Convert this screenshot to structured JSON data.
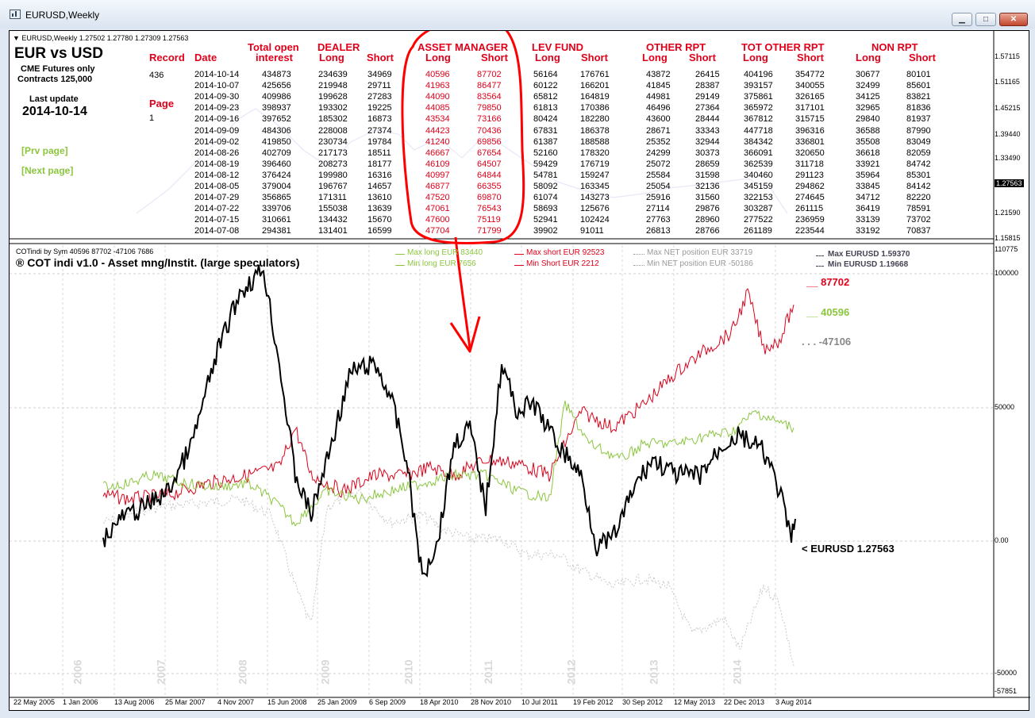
{
  "window": {
    "title": "EURUSD,Weekly",
    "buttons": {
      "minimize": "▁",
      "restore": "□",
      "close": "✕"
    }
  },
  "top_chart": {
    "info": "▼ EURUSD,Weekly  1.27502 1.27780 1.27309 1.27563",
    "yticks": [
      "1.57115",
      "1.51165",
      "1.45215",
      "1.39440",
      "1.33490",
      "1.27563",
      "1.21590",
      "1.15815"
    ],
    "current_price": "1.27563"
  },
  "panel": {
    "title": "EUR vs USD",
    "sub1": "CME Futures only",
    "sub2": "Contracts 125,000",
    "last_update_label": "Last update",
    "last_update": "2014-10-14",
    "prev_page": "[Prv page]",
    "next_page": "[Next page]",
    "record_label": "Record",
    "record_value": "436",
    "page_label": "Page",
    "page_value": "1"
  },
  "table": {
    "h_date": "Date",
    "h_oi_1": "Total open",
    "h_oi_2": "interest",
    "groups": [
      "DEALER",
      "ASSET MANAGER",
      "LEV FUND",
      "OTHER RPT",
      "TOT OTHER RPT",
      "NON RPT"
    ],
    "sub_long": "Long",
    "sub_short": "Short",
    "rows": [
      [
        "2014-10-14",
        "434873",
        "234639",
        "34969",
        "40596",
        "87702",
        "56164",
        "176761",
        "43872",
        "26415",
        "404196",
        "354772",
        "30677",
        "80101"
      ],
      [
        "2014-10-07",
        "425656",
        "219948",
        "29711",
        "41963",
        "86477",
        "60122",
        "166201",
        "41845",
        "28387",
        "393157",
        "340055",
        "32499",
        "85601"
      ],
      [
        "2014-09-30",
        "409986",
        "199628",
        "27283",
        "44090",
        "83564",
        "65812",
        "164819",
        "44981",
        "29149",
        "375861",
        "326165",
        "34125",
        "83821"
      ],
      [
        "2014-09-23",
        "398937",
        "193302",
        "19225",
        "44085",
        "79850",
        "61813",
        "170386",
        "46496",
        "27364",
        "365972",
        "317101",
        "32965",
        "81836"
      ],
      [
        "2014-09-16",
        "397652",
        "185302",
        "16873",
        "43534",
        "73166",
        "80424",
        "182280",
        "43600",
        "28444",
        "367812",
        "315715",
        "29840",
        "81937"
      ],
      [
        "2014-09-09",
        "484306",
        "228008",
        "27374",
        "44423",
        "70436",
        "67831",
        "186378",
        "28671",
        "33343",
        "447718",
        "396316",
        "36588",
        "87990"
      ],
      [
        "2014-09-02",
        "419850",
        "230734",
        "19784",
        "41240",
        "69856",
        "61387",
        "188588",
        "25352",
        "32944",
        "384342",
        "336801",
        "35508",
        "83049"
      ],
      [
        "2014-08-26",
        "402709",
        "217173",
        "18511",
        "46667",
        "67654",
        "52160",
        "178320",
        "24299",
        "30373",
        "366091",
        "320650",
        "36618",
        "82059"
      ],
      [
        "2014-08-19",
        "396460",
        "208273",
        "18177",
        "46109",
        "64507",
        "59429",
        "176719",
        "25072",
        "28659",
        "362539",
        "311718",
        "33921",
        "84742"
      ],
      [
        "2014-08-12",
        "376424",
        "199980",
        "16316",
        "40997",
        "64844",
        "54781",
        "159247",
        "25584",
        "31598",
        "340460",
        "291123",
        "35964",
        "85301"
      ],
      [
        "2014-08-05",
        "379004",
        "196767",
        "14657",
        "46877",
        "66355",
        "58092",
        "163345",
        "25054",
        "32136",
        "345159",
        "294862",
        "33845",
        "84142"
      ],
      [
        "2014-07-29",
        "356865",
        "171311",
        "13610",
        "47520",
        "69870",
        "61074",
        "143273",
        "25916",
        "31560",
        "322153",
        "274645",
        "34712",
        "82220"
      ],
      [
        "2014-07-22",
        "339706",
        "155038",
        "13639",
        "47061",
        "76543",
        "58693",
        "125676",
        "27114",
        "29876",
        "303287",
        "261115",
        "36419",
        "78591"
      ],
      [
        "2014-07-15",
        "310661",
        "134432",
        "15670",
        "47600",
        "75119",
        "52941",
        "102424",
        "27763",
        "28960",
        "277522",
        "236959",
        "33139",
        "73702"
      ],
      [
        "2014-07-08",
        "294381",
        "131401",
        "16599",
        "47704",
        "71799",
        "39902",
        "91011",
        "26813",
        "28766",
        "261189",
        "223544",
        "33192",
        "70837"
      ]
    ]
  },
  "bottom_chart": {
    "info": "COTindi by Sym 40596 87702 -47106 7686",
    "title": "® COT indi v1.0 - Asset mng/Instit. (large speculators)",
    "legend": {
      "max_long": "Max long EUR  83440",
      "min_long": "Min long EUR  7656",
      "max_short": "Max short EUR  92523",
      "min_short": "Min Short EUR  2212",
      "max_net": "Max NET position EUR  33719",
      "min_net": "Min NET position EUR  -50186",
      "max_eurusd": "Max EURUSD  1.59370",
      "min_eurusd": "Min EURUSD  1.19668"
    },
    "yticks": [
      "110775",
      "100000",
      "50000",
      "0.00",
      "-50000",
      "-57851"
    ],
    "short_label": "__ 87702",
    "long_label": "__ 40596",
    "net_label": ". . . -47106",
    "eurusd_label": "< EURUSD  1.27563",
    "year_labels": [
      "2006",
      "2007",
      "2008",
      "2009",
      "2010",
      "2011",
      "2012",
      "2013",
      "2014"
    ],
    "dates": [
      "22 May 2005",
      "1 Jan 2006",
      "13 Aug 2006",
      "25 Mar 2007",
      "4 Nov 2007",
      "15 Jun 2008",
      "25 Jan 2009",
      "6 Sep 2009",
      "18 Apr 2010",
      "28 Nov 2010",
      "10 Jul 2011",
      "19 Feb 2012",
      "30 Sep 2012",
      "12 May 2013",
      "22 Dec 2013",
      "3 Aug 2014"
    ]
  },
  "colors": {
    "short": "#e0001a",
    "long": "#8cc63f",
    "net": "#c8c8c8",
    "price": "#000000",
    "annotation": "#ff0000"
  }
}
